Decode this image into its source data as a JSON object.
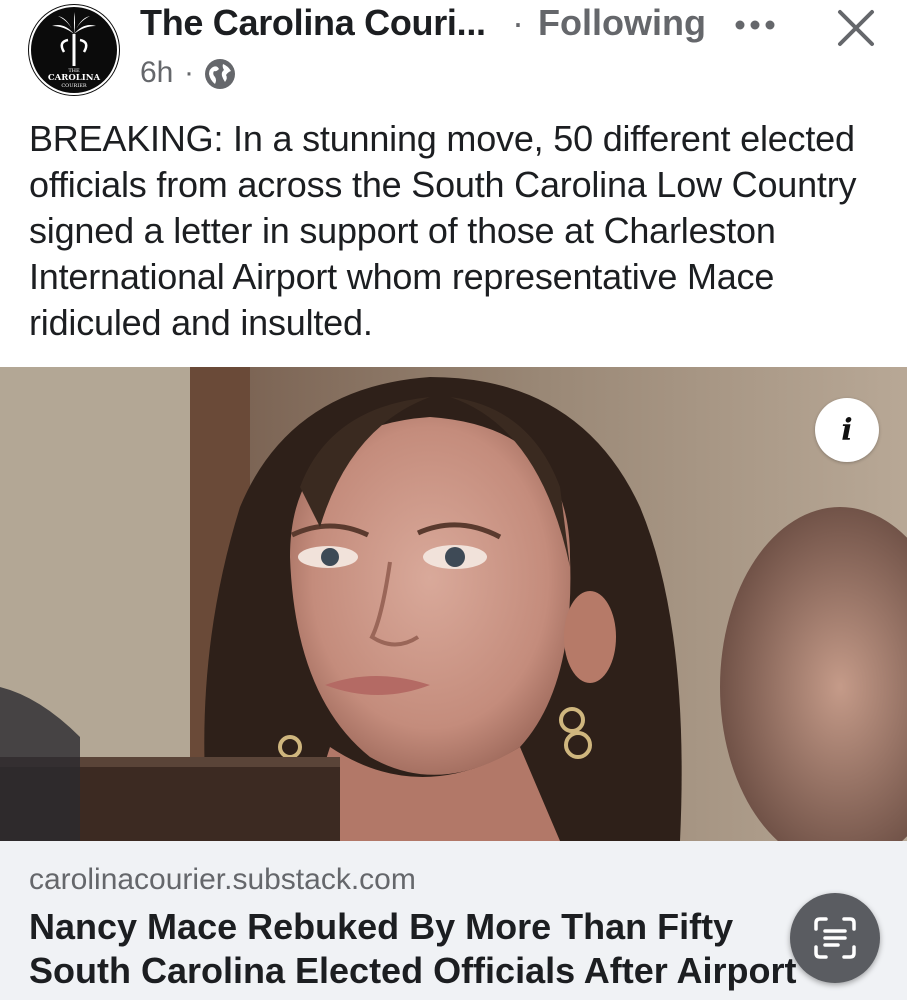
{
  "header": {
    "page_name": "The Carolina Couri...",
    "separator": "·",
    "follow_status": "Following",
    "timestamp": "6h",
    "timestamp_separator": "·",
    "more_icon": "more-horizontal-icon",
    "close_icon": "close-icon",
    "audience_icon": "globe-icon",
    "avatar_text": [
      "THE",
      "CAROLINA",
      "COURIER"
    ]
  },
  "post": {
    "text": "BREAKING: In a stunning move, 50 different elected officials from across the South Carolina Low Country signed a letter in support of those at Charleston International Airport whom representative Mace ridiculed and insulted."
  },
  "image": {
    "info_label": "i"
  },
  "link_preview": {
    "domain": "carolinacourier.substack.com",
    "title": "Nancy Mace Rebuked By More Than Fifty South Carolina Elected Officials After Airport Drama"
  },
  "overlay": {
    "scan_icon": "text-scan-icon"
  },
  "colors": {
    "text_primary": "#1c1e21",
    "text_secondary": "#65676b",
    "preview_bg": "#f0f2f5"
  }
}
